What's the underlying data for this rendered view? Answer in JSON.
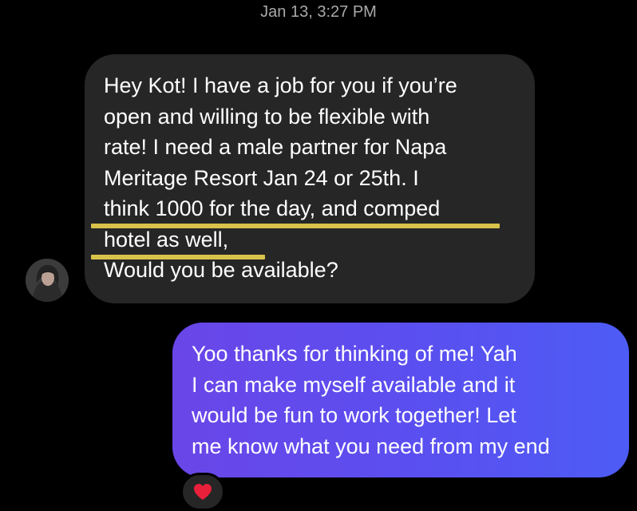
{
  "timestamp": "Jan 13, 3:27 PM",
  "incoming": {
    "sender_avatar": "avatar-photo",
    "lines": [
      "Hey Kot! I have a job for you if you’re",
      "open and willing to be flexible with",
      "rate! I need a male partner for Napa",
      "Meritage Resort Jan 24 or 25th. I",
      "think 1000 for the day, and comped",
      "hotel as well,",
      "Would you be available?"
    ],
    "highlight_color": "#d9c24a",
    "bubble_color": "#262626"
  },
  "outgoing": {
    "lines": [
      "Yoo thanks for thinking of me! Yah",
      "I can make myself available and it",
      "would be fun to work together! Let",
      "me know what you need from my end"
    ],
    "gradient": [
      "#6a46e8",
      "#4d5cf4"
    ]
  },
  "reaction": {
    "icon": "red-heart-icon",
    "color": "#e8203a"
  }
}
